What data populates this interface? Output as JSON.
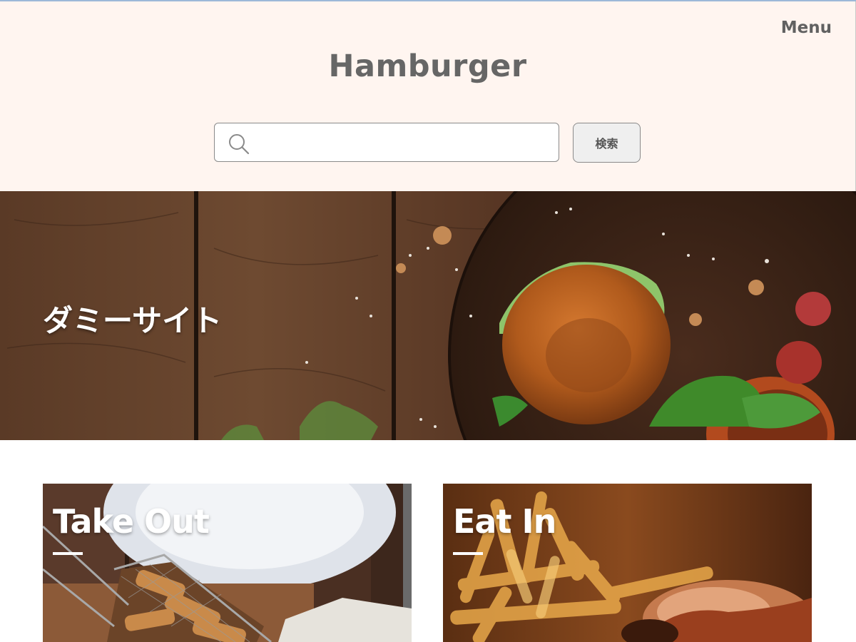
{
  "header": {
    "menu_label": "Menu",
    "site_title": "Hamburger",
    "search": {
      "placeholder": "",
      "value": "",
      "button_label": "検索"
    }
  },
  "hero": {
    "title": "ダミーサイト"
  },
  "cards": [
    {
      "title": "Take Out"
    },
    {
      "title": "Eat In"
    }
  ],
  "icons": [
    "search-icon"
  ],
  "colors": {
    "header_bg": "#fff5f0",
    "title_text": "#666666",
    "button_bg": "#efefef"
  }
}
